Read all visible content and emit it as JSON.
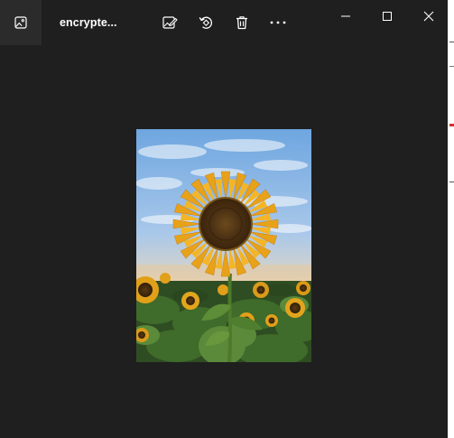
{
  "window": {
    "file_title": "encrypte...",
    "icons": {
      "app": "photo-app-icon",
      "edit": "edit-image-icon",
      "rotate": "rotate-icon",
      "delete": "trash-icon",
      "more": "more-options-icon",
      "minimize": "minimize-icon",
      "maximize": "maximize-icon",
      "close": "close-icon"
    },
    "colors": {
      "background": "#1f1f1f",
      "icon": "#ffffff"
    }
  },
  "image": {
    "subject": "sunflower-photo"
  }
}
